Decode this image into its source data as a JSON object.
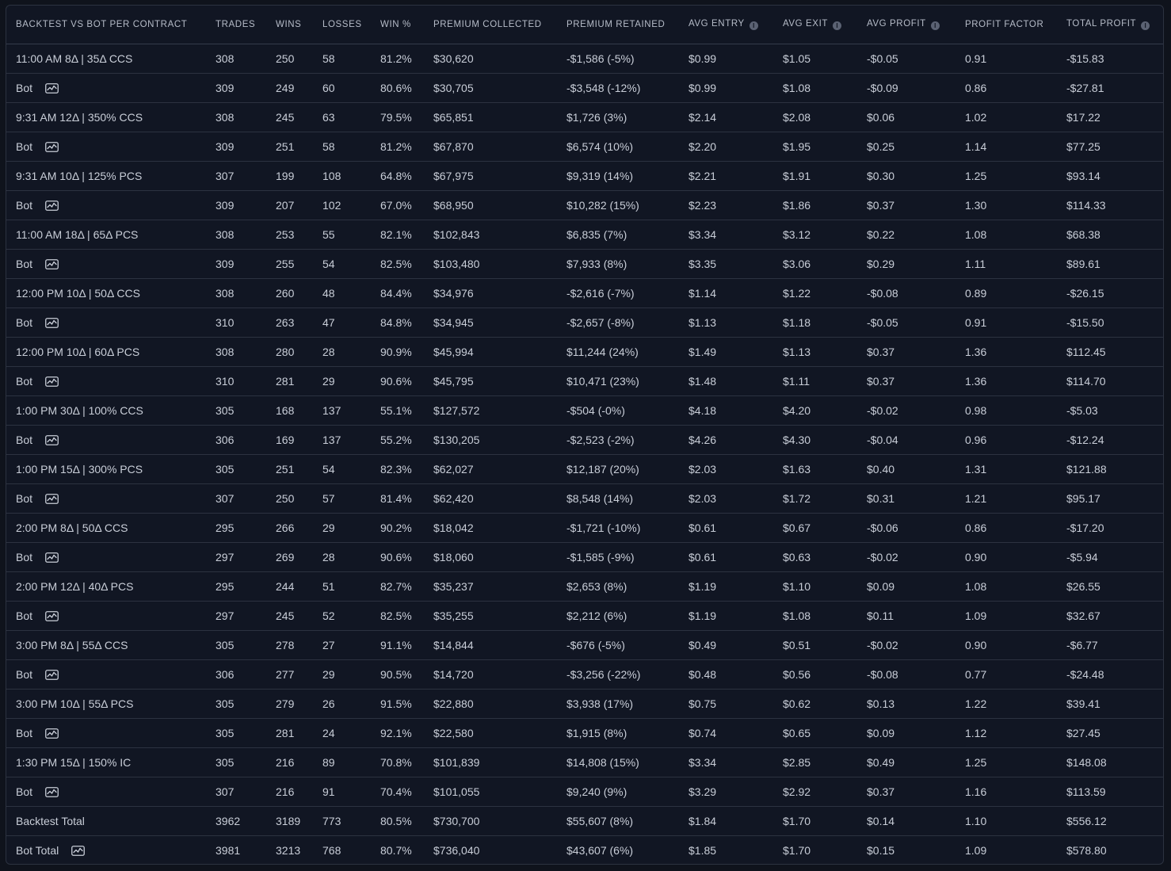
{
  "headers": [
    {
      "label": "Backtest vs Bot Per Contract",
      "info": false
    },
    {
      "label": "Trades",
      "info": false
    },
    {
      "label": "Wins",
      "info": false
    },
    {
      "label": "Losses",
      "info": false
    },
    {
      "label": "Win %",
      "info": false
    },
    {
      "label": "Premium Collected",
      "info": false
    },
    {
      "label": "Premium Retained",
      "info": false
    },
    {
      "label": "Avg Entry",
      "info": true
    },
    {
      "label": "Avg Exit",
      "info": true
    },
    {
      "label": "Avg Profit",
      "info": true
    },
    {
      "label": "Profit Factor",
      "info": false
    },
    {
      "label": "Total Profit",
      "info": true
    }
  ],
  "rows": [
    {
      "label": "11:00 AM 8Δ | 35Δ CCS",
      "bot": false,
      "cells": [
        "308",
        "250",
        "58",
        "81.2%",
        "$30,620",
        "-$1,586 (-5%)",
        "$0.99",
        "$1.05",
        "-$0.05",
        "0.91",
        "-$15.83"
      ]
    },
    {
      "label": "Bot",
      "bot": true,
      "cells": [
        "309",
        "249",
        "60",
        "80.6%",
        "$30,705",
        "-$3,548 (-12%)",
        "$0.99",
        "$1.08",
        "-$0.09",
        "0.86",
        "-$27.81"
      ]
    },
    {
      "label": "9:31 AM 12Δ | 350% CCS",
      "bot": false,
      "cells": [
        "308",
        "245",
        "63",
        "79.5%",
        "$65,851",
        "$1,726 (3%)",
        "$2.14",
        "$2.08",
        "$0.06",
        "1.02",
        "$17.22"
      ]
    },
    {
      "label": "Bot",
      "bot": true,
      "cells": [
        "309",
        "251",
        "58",
        "81.2%",
        "$67,870",
        "$6,574 (10%)",
        "$2.20",
        "$1.95",
        "$0.25",
        "1.14",
        "$77.25"
      ]
    },
    {
      "label": "9:31 AM 10Δ | 125% PCS",
      "bot": false,
      "cells": [
        "307",
        "199",
        "108",
        "64.8%",
        "$67,975",
        "$9,319 (14%)",
        "$2.21",
        "$1.91",
        "$0.30",
        "1.25",
        "$93.14"
      ]
    },
    {
      "label": "Bot",
      "bot": true,
      "cells": [
        "309",
        "207",
        "102",
        "67.0%",
        "$68,950",
        "$10,282 (15%)",
        "$2.23",
        "$1.86",
        "$0.37",
        "1.30",
        "$114.33"
      ]
    },
    {
      "label": "11:00 AM 18Δ | 65Δ PCS",
      "bot": false,
      "cells": [
        "308",
        "253",
        "55",
        "82.1%",
        "$102,843",
        "$6,835 (7%)",
        "$3.34",
        "$3.12",
        "$0.22",
        "1.08",
        "$68.38"
      ]
    },
    {
      "label": "Bot",
      "bot": true,
      "cells": [
        "309",
        "255",
        "54",
        "82.5%",
        "$103,480",
        "$7,933 (8%)",
        "$3.35",
        "$3.06",
        "$0.29",
        "1.11",
        "$89.61"
      ]
    },
    {
      "label": "12:00 PM 10Δ | 50Δ CCS",
      "bot": false,
      "cells": [
        "308",
        "260",
        "48",
        "84.4%",
        "$34,976",
        "-$2,616 (-7%)",
        "$1.14",
        "$1.22",
        "-$0.08",
        "0.89",
        "-$26.15"
      ]
    },
    {
      "label": "Bot",
      "bot": true,
      "cells": [
        "310",
        "263",
        "47",
        "84.8%",
        "$34,945",
        "-$2,657 (-8%)",
        "$1.13",
        "$1.18",
        "-$0.05",
        "0.91",
        "-$15.50"
      ]
    },
    {
      "label": "12:00 PM 10Δ | 60Δ PCS",
      "bot": false,
      "cells": [
        "308",
        "280",
        "28",
        "90.9%",
        "$45,994",
        "$11,244 (24%)",
        "$1.49",
        "$1.13",
        "$0.37",
        "1.36",
        "$112.45"
      ]
    },
    {
      "label": "Bot",
      "bot": true,
      "cells": [
        "310",
        "281",
        "29",
        "90.6%",
        "$45,795",
        "$10,471 (23%)",
        "$1.48",
        "$1.11",
        "$0.37",
        "1.36",
        "$114.70"
      ]
    },
    {
      "label": "1:00 PM 30Δ | 100% CCS",
      "bot": false,
      "cells": [
        "305",
        "168",
        "137",
        "55.1%",
        "$127,572",
        "-$504 (-0%)",
        "$4.18",
        "$4.20",
        "-$0.02",
        "0.98",
        "-$5.03"
      ]
    },
    {
      "label": "Bot",
      "bot": true,
      "cells": [
        "306",
        "169",
        "137",
        "55.2%",
        "$130,205",
        "-$2,523 (-2%)",
        "$4.26",
        "$4.30",
        "-$0.04",
        "0.96",
        "-$12.24"
      ]
    },
    {
      "label": "1:00 PM 15Δ | 300% PCS",
      "bot": false,
      "cells": [
        "305",
        "251",
        "54",
        "82.3%",
        "$62,027",
        "$12,187 (20%)",
        "$2.03",
        "$1.63",
        "$0.40",
        "1.31",
        "$121.88"
      ]
    },
    {
      "label": "Bot",
      "bot": true,
      "cells": [
        "307",
        "250",
        "57",
        "81.4%",
        "$62,420",
        "$8,548 (14%)",
        "$2.03",
        "$1.72",
        "$0.31",
        "1.21",
        "$95.17"
      ]
    },
    {
      "label": "2:00 PM 8Δ | 50Δ CCS",
      "bot": false,
      "cells": [
        "295",
        "266",
        "29",
        "90.2%",
        "$18,042",
        "-$1,721 (-10%)",
        "$0.61",
        "$0.67",
        "-$0.06",
        "0.86",
        "-$17.20"
      ]
    },
    {
      "label": "Bot",
      "bot": true,
      "cells": [
        "297",
        "269",
        "28",
        "90.6%",
        "$18,060",
        "-$1,585 (-9%)",
        "$0.61",
        "$0.63",
        "-$0.02",
        "0.90",
        "-$5.94"
      ]
    },
    {
      "label": "2:00 PM 12Δ | 40Δ PCS",
      "bot": false,
      "cells": [
        "295",
        "244",
        "51",
        "82.7%",
        "$35,237",
        "$2,653 (8%)",
        "$1.19",
        "$1.10",
        "$0.09",
        "1.08",
        "$26.55"
      ]
    },
    {
      "label": "Bot",
      "bot": true,
      "cells": [
        "297",
        "245",
        "52",
        "82.5%",
        "$35,255",
        "$2,212 (6%)",
        "$1.19",
        "$1.08",
        "$0.11",
        "1.09",
        "$32.67"
      ]
    },
    {
      "label": "3:00 PM 8Δ | 55Δ CCS",
      "bot": false,
      "cells": [
        "305",
        "278",
        "27",
        "91.1%",
        "$14,844",
        "-$676 (-5%)",
        "$0.49",
        "$0.51",
        "-$0.02",
        "0.90",
        "-$6.77"
      ]
    },
    {
      "label": "Bot",
      "bot": true,
      "cells": [
        "306",
        "277",
        "29",
        "90.5%",
        "$14,720",
        "-$3,256 (-22%)",
        "$0.48",
        "$0.56",
        "-$0.08",
        "0.77",
        "-$24.48"
      ]
    },
    {
      "label": "3:00 PM 10Δ | 55Δ PCS",
      "bot": false,
      "cells": [
        "305",
        "279",
        "26",
        "91.5%",
        "$22,880",
        "$3,938 (17%)",
        "$0.75",
        "$0.62",
        "$0.13",
        "1.22",
        "$39.41"
      ]
    },
    {
      "label": "Bot",
      "bot": true,
      "cells": [
        "305",
        "281",
        "24",
        "92.1%",
        "$22,580",
        "$1,915 (8%)",
        "$0.74",
        "$0.65",
        "$0.09",
        "1.12",
        "$27.45"
      ]
    },
    {
      "label": "1:30 PM 15Δ | 150% IC",
      "bot": false,
      "cells": [
        "305",
        "216",
        "89",
        "70.8%",
        "$101,839",
        "$14,808 (15%)",
        "$3.34",
        "$2.85",
        "$0.49",
        "1.25",
        "$148.08"
      ]
    },
    {
      "label": "Bot",
      "bot": true,
      "cells": [
        "307",
        "216",
        "91",
        "70.4%",
        "$101,055",
        "$9,240 (9%)",
        "$3.29",
        "$2.92",
        "$0.37",
        "1.16",
        "$113.59"
      ]
    },
    {
      "label": "Backtest Total",
      "bot": false,
      "cells": [
        "3962",
        "3189",
        "773",
        "80.5%",
        "$730,700",
        "$55,607 (8%)",
        "$1.84",
        "$1.70",
        "$0.14",
        "1.10",
        "$556.12"
      ]
    },
    {
      "label": "Bot Total",
      "bot": true,
      "cells": [
        "3981",
        "3213",
        "768",
        "80.7%",
        "$736,040",
        "$43,607 (6%)",
        "$1.85",
        "$1.70",
        "$0.15",
        "1.09",
        "$578.80"
      ]
    }
  ],
  "icons": {
    "info": "info-icon",
    "bot_chart": "chart-icon"
  },
  "colors": {
    "background": "#111623",
    "border": "#2c3240",
    "text": "#c9ced8",
    "header_text": "#b6bcc8"
  },
  "info_glyph": "i"
}
